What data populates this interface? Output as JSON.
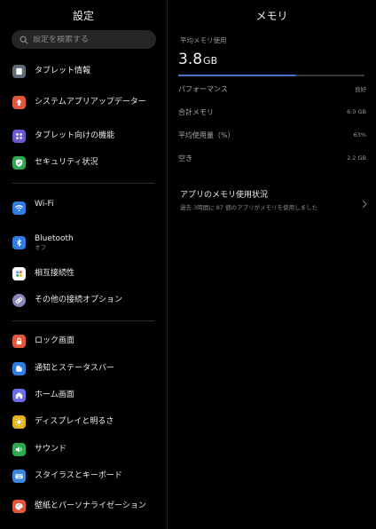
{
  "left_pane": {
    "title": "設定",
    "search_placeholder": "設定を検索する",
    "groups": [
      [
        {
          "name": "tablet-info",
          "label": "タブレット情報",
          "icon": "tablet-icon",
          "color": "#5f6c7b"
        },
        {
          "name": "system-update",
          "label": "システムアプリアップデーター",
          "icon": "arrow-up-icon",
          "color": "#e2573c"
        },
        {
          "name": "tablet-features",
          "label": "タブレット向けの機能",
          "icon": "grid-icon",
          "color": "#6a5acd"
        },
        {
          "name": "security",
          "label": "セキュリティ状況",
          "icon": "shield-icon",
          "color": "#2fa84f"
        }
      ],
      [
        {
          "name": "wifi",
          "label": "Wi-Fi",
          "sub": "·",
          "icon": "wifi-icon",
          "color": "#2f7de1"
        },
        {
          "name": "bluetooth",
          "label": "Bluetooth",
          "sub": "オフ",
          "icon": "bluetooth-icon",
          "color": "#2f7de1"
        },
        {
          "name": "interconnect",
          "label": "相互接続性",
          "icon": "dots-icon",
          "color": "#ffffff"
        },
        {
          "name": "other-connections",
          "label": "その他の接続オプション",
          "icon": "link-icon",
          "color": "#8a86b8"
        }
      ],
      [
        {
          "name": "lock-screen",
          "label": "ロック画面",
          "icon": "lock-icon",
          "color": "#e2573c"
        },
        {
          "name": "notifications",
          "label": "通知とステータスバー",
          "icon": "bell-icon",
          "color": "#2f7de1"
        },
        {
          "name": "home-screen",
          "label": "ホーム画面",
          "icon": "home-icon",
          "color": "#6a6ee8"
        },
        {
          "name": "display",
          "label": "ディスプレイと明るさ",
          "icon": "sun-icon",
          "color": "#e3b21f"
        },
        {
          "name": "sound",
          "label": "サウンド",
          "icon": "speaker-icon",
          "color": "#2fa84f"
        },
        {
          "name": "stylus-keyboard",
          "label": "スタイラスとキーボード",
          "icon": "keyboard-icon",
          "color": "#3b86e0"
        },
        {
          "name": "wallpaper",
          "label": "壁紙とパーソナライゼーション",
          "icon": "palette-icon",
          "color": "#e2573c"
        }
      ]
    ]
  },
  "right_pane": {
    "title": "メモリ",
    "avg_label": "平均メモリ使用",
    "avg_value": "3.8",
    "avg_unit": "GB",
    "usage_fraction": 0.63,
    "rows": [
      {
        "key": "パフォーマンス",
        "value": "良好"
      },
      {
        "key": "合計メモリ",
        "value": "6.0 GB"
      },
      {
        "key": "平均使用量（%）",
        "value": "63%"
      },
      {
        "key": "空き",
        "value": "2.2 GB"
      }
    ],
    "app_usage": {
      "title": "アプリのメモリ使用状況",
      "subtitle": "過去 3時間に 87 個のアプリがメモリを使用しました"
    }
  },
  "colors": {
    "accent": "#4a73c8",
    "background": "#000000"
  }
}
